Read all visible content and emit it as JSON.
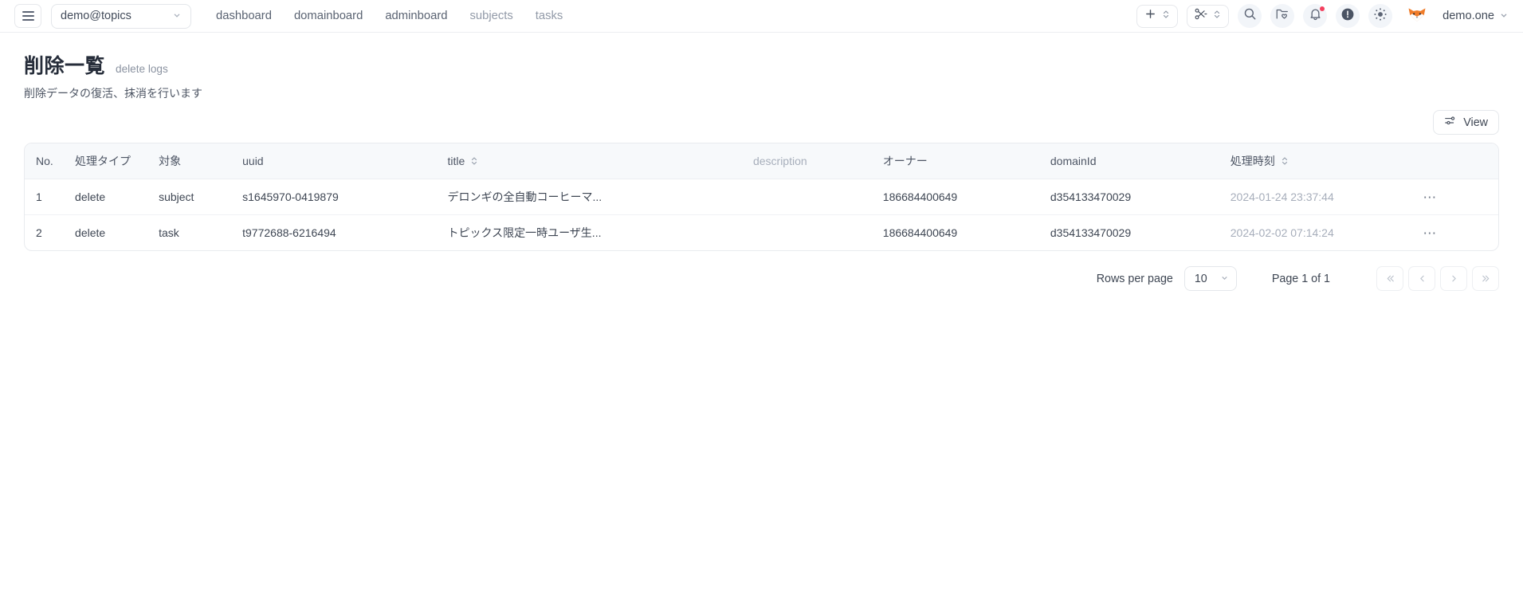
{
  "topbar": {
    "menu_icon": "hamburger-icon",
    "org_selector": {
      "value": "demo@topics",
      "caret": "⌄"
    },
    "nav": [
      {
        "label": "dashboard",
        "muted": false
      },
      {
        "label": "domainboard",
        "muted": false
      },
      {
        "label": "adminboard",
        "muted": false
      },
      {
        "label": "subjects",
        "muted": true
      },
      {
        "label": "tasks",
        "muted": true
      }
    ],
    "actions": {
      "add": {
        "icon": "plus-icon",
        "stepper": "chevron-up-down-icon"
      },
      "cut": {
        "icon": "scissors-icon",
        "stepper": "chevron-up-down-icon"
      },
      "search": {
        "icon": "search-icon"
      },
      "folder": {
        "icon": "folder-heart-icon"
      },
      "notifications": {
        "icon": "bell-icon",
        "has_unread": true,
        "dot_color": "#f43f5e"
      },
      "alerts": {
        "icon": "exclamation-circle-icon"
      },
      "theme": {
        "icon": "sun-icon"
      }
    },
    "user": {
      "avatar": "fox-avatar",
      "name": "demo.one",
      "caret": "⌄"
    }
  },
  "page": {
    "title": "削除一覧",
    "title_en": "delete logs",
    "subtitle": "削除データの復活、抹消を行います"
  },
  "toolbar": {
    "view_label": "View",
    "view_icon": "sliders-icon"
  },
  "table": {
    "columns": [
      {
        "key": "no",
        "label": "No.",
        "sortable": false,
        "muted": false
      },
      {
        "key": "type",
        "label": "処理タイプ",
        "sortable": false,
        "muted": false
      },
      {
        "key": "target",
        "label": "対象",
        "sortable": false,
        "muted": false
      },
      {
        "key": "uuid",
        "label": "uuid",
        "sortable": false,
        "muted": false
      },
      {
        "key": "title",
        "label": "title",
        "sortable": true,
        "muted": false
      },
      {
        "key": "description",
        "label": "description",
        "sortable": false,
        "muted": true
      },
      {
        "key": "owner",
        "label": "オーナー",
        "sortable": false,
        "muted": false
      },
      {
        "key": "domainId",
        "label": "domainId",
        "sortable": false,
        "muted": false
      },
      {
        "key": "processedAt",
        "label": "処理時刻",
        "sortable": true,
        "muted": false
      },
      {
        "key": "actions",
        "label": "",
        "sortable": false,
        "muted": false
      }
    ],
    "rows": [
      {
        "no": "1",
        "type": "delete",
        "target": "subject",
        "uuid": "s1645970-0419879",
        "title": "デロンギの全自動コーヒーマ...",
        "description": "",
        "owner": "186684400649",
        "domainId": "d354133470029",
        "processedAt": "2024-01-24 23:37:44",
        "actions": "⋯"
      },
      {
        "no": "2",
        "type": "delete",
        "target": "task",
        "uuid": "t9772688-6216494",
        "title": "トピックス限定一時ユーザ生...",
        "description": "",
        "owner": "186684400649",
        "domainId": "d354133470029",
        "processedAt": "2024-02-02 07:14:24",
        "actions": "⋯"
      }
    ]
  },
  "pagination": {
    "rows_per_page_label": "Rows per page",
    "rows_per_page_value": "10",
    "page_status": "Page 1 of 1",
    "first_label": "«",
    "prev_label": "‹",
    "next_label": "›",
    "last_label": "»"
  },
  "colors": {
    "accent": "#f43f5e",
    "text": "#3f4754",
    "muted": "#a7aebb",
    "border": "#e9ebef",
    "header_bg": "#f7f9fb"
  }
}
